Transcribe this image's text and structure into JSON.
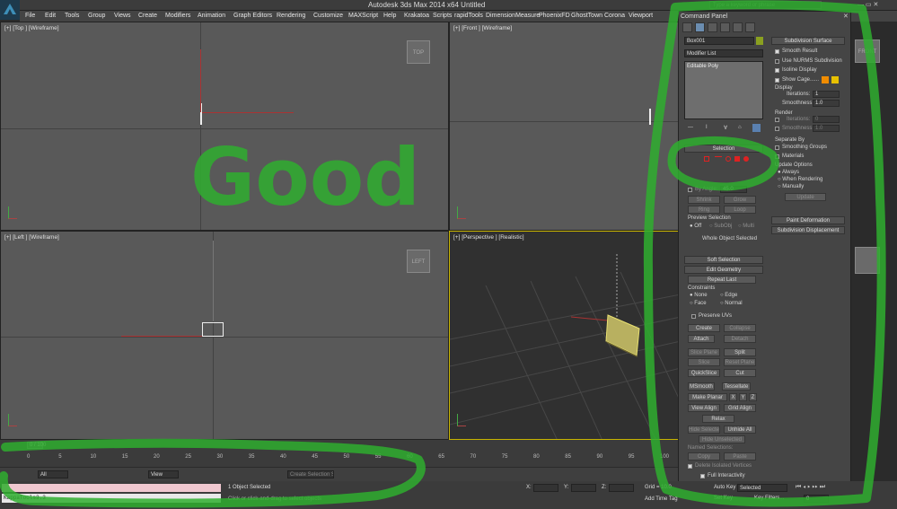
{
  "window": {
    "title": "Autodesk 3ds Max 2014 x64      Untitled",
    "search_placeholder": "Type a keyword or phrase"
  },
  "menu": [
    "File",
    "Edit",
    "Tools",
    "Group",
    "Views",
    "Create",
    "Modifiers",
    "Animation",
    "Graph Editors",
    "Rendering",
    "Customize",
    "MAXScript",
    "Help",
    "Krakatoa",
    "Scripts",
    "rapidTools",
    "DimensionMeasure",
    "PhoenixFD",
    "GhostTown",
    "Corona",
    "Viewport"
  ],
  "viewports": {
    "top": {
      "label": "[+] [Top ] [Wireframe]",
      "cube": "TOP"
    },
    "front": {
      "label": "[+] [Front ] [Wireframe]",
      "cube": "FRONT"
    },
    "left": {
      "label": "[+] [Left ] [Wireframe]",
      "cube": "LEFT"
    },
    "perspective": {
      "label": "[+] [Perspective ] [Realistic]"
    }
  },
  "handwritten_text": "Good",
  "command_panel": {
    "title": "Command Panel",
    "object_name": "Box001",
    "modifier_list": "Modifier List",
    "stack_item": "Editable Poly",
    "selection_rollout": "Selection",
    "by_angle": "By Angle:",
    "by_angle_value": "45.0",
    "shrink": "Shrink",
    "grow": "Grow",
    "ring": "Ring",
    "loop": "Loop",
    "preview_selection": "Preview Selection",
    "preview_off": "Off",
    "preview_subobj": "SubObj",
    "preview_multi": "Multi",
    "whole_object": "Whole Object Selected",
    "soft_selection": "Soft Selection",
    "edit_geometry": "Edit Geometry",
    "repeat_last": "Repeat Last",
    "constraints": "Constraints",
    "c_none": "None",
    "c_edge": "Edge",
    "c_face": "Face",
    "c_normal": "Normal",
    "preserve_uvs": "Preserve UVs",
    "create": "Create",
    "collapse": "Collapse",
    "attach": "Attach",
    "detach": "Detach",
    "slice_plane": "Slice Plane",
    "split": "Split",
    "slice": "Slice",
    "reset_plane": "Reset Plane",
    "quickslice": "QuickSlice",
    "cut": "Cut",
    "msmooth": "MSmooth",
    "tessellate": "Tessellate",
    "make_planar": "Make Planar",
    "x": "X",
    "y": "Y",
    "z": "Z",
    "view_align": "View Align",
    "grid_align": "Grid Align",
    "relax": "Relax",
    "hide_selected": "Hide Selected",
    "unhide_all": "Unhide All",
    "hide_unselected": "Hide Unselected",
    "named_selections": "Named Selections:",
    "copy": "Copy",
    "paste": "Paste",
    "delete_isolated": "Delete Isolated Vertices",
    "full_interactivity": "Full Interactivity",
    "subdiv_surface": "Subdivision Surface",
    "smooth_result": "Smooth Result",
    "use_nurms": "Use NURMS Subdivision",
    "isoline_display": "Isoline Display",
    "show_cage": "Show Cage......",
    "display": "Display",
    "iterations": "Iterations:",
    "iterations_value": "1",
    "smoothness": "Smoothness:",
    "smoothness_value": "1.0",
    "render": "Render",
    "r_iterations": "Iterations:",
    "r_iterations_value": "0",
    "r_smoothness": "Smoothness:",
    "r_smoothness_value": "1.0",
    "separate_by": "Separate By",
    "smoothing_groups": "Smoothing Groups",
    "materials": "Materials",
    "update_options": "Update Options",
    "always": "Always",
    "when_rendering": "When Rendering",
    "manually": "Manually",
    "update": "Update",
    "paint_deformation": "Paint Deformation",
    "subdiv_displacement": "Subdivision Displacement",
    "cage_color_1": "#f08c00",
    "cage_color_2": "#e8c000"
  },
  "timeline": {
    "frame": "0 / 100",
    "ticks": [
      "0",
      "5",
      "10",
      "15",
      "20",
      "25",
      "30",
      "35",
      "40",
      "45",
      "50",
      "55",
      "60",
      "65",
      "70",
      "75",
      "80",
      "85",
      "90",
      "95",
      "100"
    ]
  },
  "toolbar": {
    "filter": "All",
    "view": "View",
    "selection_set": "Create Selection Se"
  },
  "status": {
    "script": "KappaTools3.3",
    "objects": "1 Object Selected",
    "prompt": "Click or click-and-drag to select objects",
    "x": "X:",
    "y": "Y:",
    "z": "Z:",
    "grid": "Grid = 10.0",
    "add_time_tag": "Add Time Tag",
    "auto_key": "Auto Key",
    "auto_key_mode": "Selected",
    "set_key": "Set Key",
    "key_filters": "Key Filters...",
    "frame_field": "0"
  },
  "colors": {
    "annotation": "#2fae2f",
    "viewport": "#595959",
    "panel": "#454545",
    "active_border": "#c8b400"
  }
}
